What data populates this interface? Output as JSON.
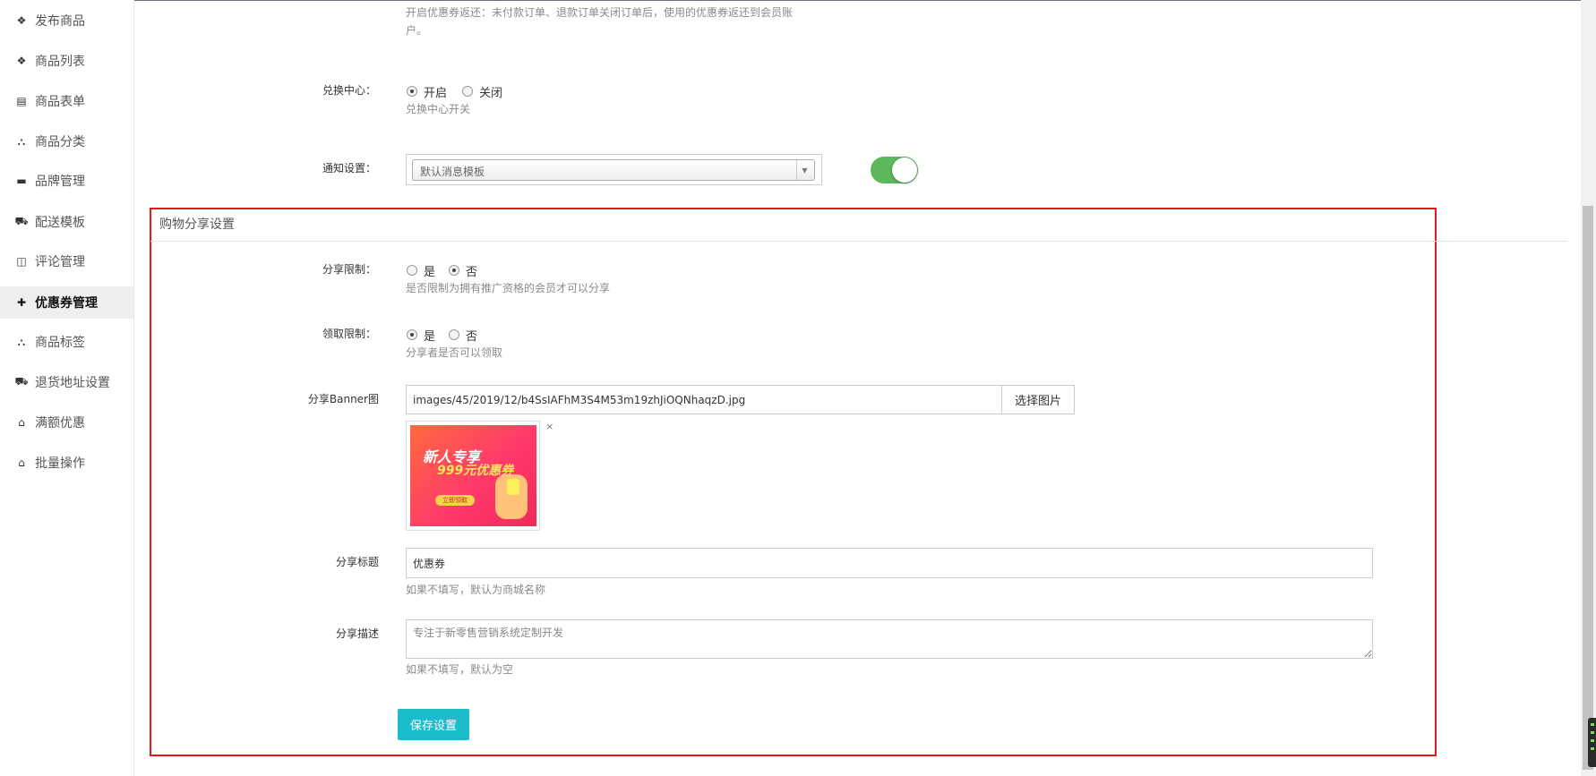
{
  "sidebar": {
    "items": [
      {
        "label": "发布商品",
        "icon": "cubes-icon",
        "glyph": "❖",
        "active": false
      },
      {
        "label": "商品列表",
        "icon": "cubes-icon",
        "glyph": "❖",
        "active": false
      },
      {
        "label": "商品表单",
        "icon": "excel-file-icon",
        "glyph": "▤",
        "active": false
      },
      {
        "label": "商品分类",
        "icon": "sitemap-icon",
        "glyph": "⛬",
        "active": false
      },
      {
        "label": "品牌管理",
        "icon": "briefcase-icon",
        "glyph": "▬",
        "active": false
      },
      {
        "label": "配送模板",
        "icon": "truck-icon",
        "glyph": "⛟",
        "active": false
      },
      {
        "label": "评论管理",
        "icon": "columns-icon",
        "glyph": "◫",
        "active": false
      },
      {
        "label": "优惠券管理",
        "icon": "tags-icon",
        "glyph": "✚",
        "active": true
      },
      {
        "label": "商品标签",
        "icon": "sitemap-icon",
        "glyph": "⛬",
        "active": false
      },
      {
        "label": "退货地址设置",
        "icon": "truck-icon",
        "glyph": "⛟",
        "active": false
      },
      {
        "label": "满额优惠",
        "icon": "gift-icon",
        "glyph": "⌂",
        "active": false
      },
      {
        "label": "批量操作",
        "icon": "gift-icon",
        "glyph": "⌂",
        "active": false
      }
    ]
  },
  "top_hint": {
    "line1": "开启优惠券返还：未付款订单、退款订单关闭订单后，使用的优惠券返还到会员账",
    "line2": "户。"
  },
  "exchange": {
    "label": "兑换中心：",
    "options": [
      "开启",
      "关闭"
    ],
    "selected": "开启",
    "hint": "兑换中心开关"
  },
  "notify": {
    "label": "通知设置：",
    "selected": "默认消息模板",
    "toggle_on": true
  },
  "share_section": {
    "title": "购物分享设置",
    "share_limit": {
      "label": "分享限制：",
      "options": [
        "是",
        "否"
      ],
      "selected": "否",
      "hint": "是否限制为拥有推广资格的会员才可以分享"
    },
    "receive_limit": {
      "label": "领取限制：",
      "options": [
        "是",
        "否"
      ],
      "selected": "是",
      "hint": "分享者是否可以领取"
    },
    "banner": {
      "label": "分享Banner图",
      "path": "images/45/2019/12/b4SsIAFhM3S4M53m19zhJiOQNhaqzD.jpg",
      "choose_label": "选择图片",
      "close_glyph": "×",
      "image_text_1": "新人专享",
      "image_text_2": "999元优惠券",
      "image_button": "立即领取"
    },
    "title_field": {
      "label": "分享标题",
      "value": "优惠券",
      "hint": "如果不填写，默认为商城名称"
    },
    "desc_field": {
      "label": "分享描述",
      "value": "专注于新零售营销系统定制开发",
      "hint": "如果不填写，默认为空"
    },
    "save_label": "保存设置"
  },
  "colors": {
    "highlight_frame": "#e3191e",
    "save_button": "#1bbccc",
    "toggle": "#5cb85c"
  }
}
